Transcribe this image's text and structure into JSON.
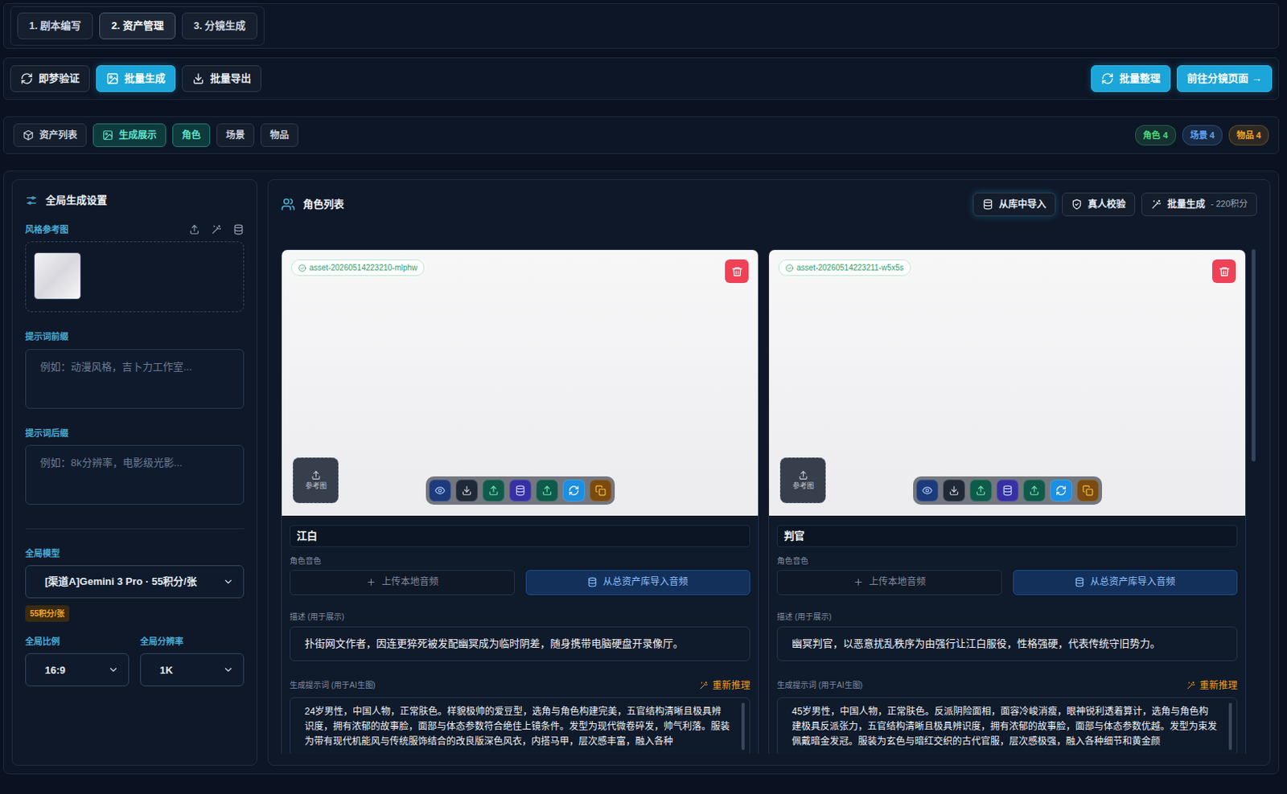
{
  "steps": [
    {
      "label": "1. 剧本编写",
      "selected": false
    },
    {
      "label": "2. 资产管理",
      "selected": true
    },
    {
      "label": "3. 分镜生成",
      "selected": false
    }
  ],
  "toolbar": {
    "left": [
      {
        "label": "即梦验证",
        "selected": false
      },
      {
        "label": "批量生成",
        "selected": true
      },
      {
        "label": "批量导出",
        "selected": false
      }
    ],
    "right": [
      {
        "label": "批量整理"
      },
      {
        "label": "前往分镜页面 →"
      }
    ]
  },
  "view_tabs": [
    {
      "label": "资产列表",
      "selected": false
    },
    {
      "label": "生成展示",
      "selected": true
    }
  ],
  "category_tabs": [
    {
      "label": "角色",
      "selected": true
    },
    {
      "label": "场景",
      "selected": false
    },
    {
      "label": "物品",
      "selected": false
    }
  ],
  "counts": [
    {
      "label": "角色 4",
      "color": "#4ade80"
    },
    {
      "label": "场景 4",
      "color": "#60a5fa"
    },
    {
      "label": "物品 4",
      "color": "#f5a623"
    }
  ],
  "settings": {
    "title": "全局生成设置",
    "style_ref": {
      "label": "风格参考图"
    },
    "prefix": {
      "label": "提示词前缀",
      "placeholder": "例如：动漫风格，吉卜力工作室..."
    },
    "suffix": {
      "label": "提示词后缀",
      "placeholder": "例如：8k分辨率，电影级光影..."
    },
    "model": {
      "label": "全局模型",
      "value": "[渠道A]Gemini 3 Pro · 55积分/张",
      "cost": "55积分/张"
    },
    "ratio": {
      "label": "全局比例",
      "value": "16:9"
    },
    "resolution": {
      "label": "全局分辨率",
      "value": "1K"
    }
  },
  "character_list": {
    "title": "角色列表",
    "buttons": [
      {
        "label": "从库中导入",
        "note": "",
        "primary": true
      },
      {
        "label": "真人校验",
        "note": "",
        "primary": false
      },
      {
        "label": "批量生成",
        "note": "- 220积分",
        "primary": false
      }
    ]
  },
  "cards": [
    {
      "asset_id": "asset-20260514223210-mlphw",
      "ref_label": "参考图",
      "name": "江白",
      "voice_label": "角色音色",
      "upload_audio": "上传本地音频",
      "import_audio": "从总资产库导入音频",
      "desc_label": "描述 (用于展示)",
      "description": "扑街网文作者，因连更猝死被发配幽冥成为临时阴差，随身携带电脑硬盘开录像厅。",
      "prompt_label": "生成提示词 (用于AI生图)",
      "rethink": "重新推理",
      "prompt": "24岁男性，中国人物，正常肤色。样貌极帅的爱豆型，选角与角色构建完美，五官结构清晰且极具辨识度，拥有浓郁的故事脸，面部与体态参数符合绝佳上镜条件。发型为现代微卷碎发，帅气利落。服装为带有现代机能风与传统服饰结合的改良版深色风衣，内搭马甲，层次感丰富，融入各种"
    },
    {
      "asset_id": "asset-20260514223211-w5x5s",
      "ref_label": "参考图",
      "name": "判官",
      "voice_label": "角色音色",
      "upload_audio": "上传本地音频",
      "import_audio": "从总资产库导入音频",
      "desc_label": "描述 (用于展示)",
      "description": "幽冥判官，以恶意扰乱秩序为由强行让江白服役，性格强硬，代表传统守旧势力。",
      "prompt_label": "生成提示词 (用于AI生图)",
      "rethink": "重新推理",
      "prompt": "45岁男性，中国人物，正常肤色。反派阴险面相，面容冷峻消瘦，眼神锐利透着算计，选角与角色构建极具反派张力，五官结构清晰且极具辨识度，拥有浓郁的故事脸，面部与体态参数优越。发型为束发佩戴暗金发冠。服装为玄色与暗红交织的古代官服，层次感极强，融入各种细节和黄金颜"
    }
  ]
}
